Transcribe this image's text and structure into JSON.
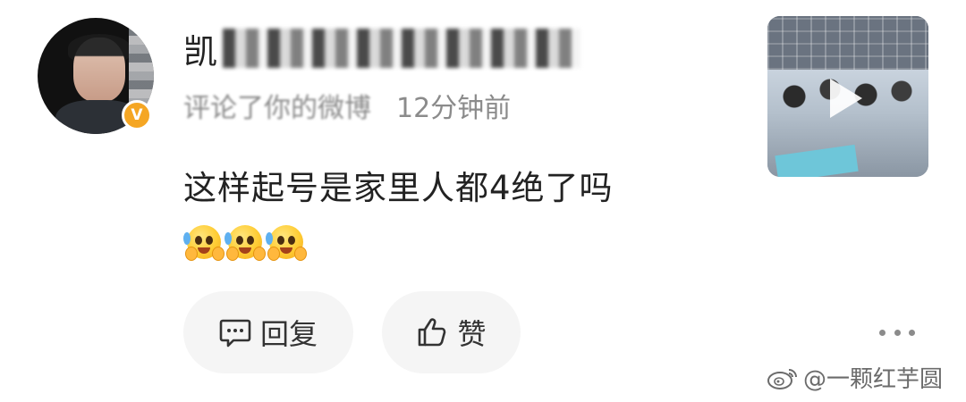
{
  "comment": {
    "username_visible": "凯",
    "action_text": "评论了你的微博",
    "time": "12分钟前",
    "content": "这样起号是家里人都4绝了吗",
    "emojis": [
      "crying-laugh-emoji",
      "crying-laugh-emoji",
      "crying-laugh-emoji"
    ],
    "vip_badge": "V"
  },
  "actions": {
    "reply_label": "回复",
    "like_label": "赞"
  },
  "watermark": {
    "text": "@一颗红芋圆"
  },
  "colors": {
    "text_primary": "#222222",
    "text_secondary": "#8b8b8b",
    "button_bg": "#f5f5f5",
    "badge": "#f5a623"
  }
}
